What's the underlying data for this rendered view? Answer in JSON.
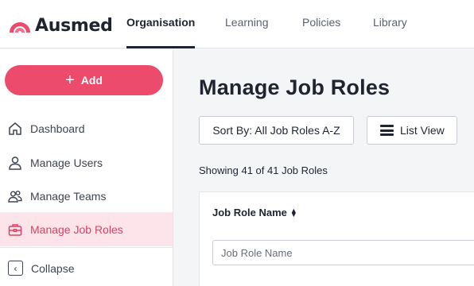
{
  "brand": {
    "name": "Ausmed",
    "accent": "#ec4b6c"
  },
  "topnav": {
    "tabs": [
      {
        "label": "Organisation",
        "active": true
      },
      {
        "label": "Learning",
        "active": false
      },
      {
        "label": "Policies",
        "active": false
      },
      {
        "label": "Library",
        "active": false
      }
    ]
  },
  "sidebar": {
    "add_label": "Add",
    "items": [
      {
        "label": "Dashboard",
        "icon": "home-icon"
      },
      {
        "label": "Manage Users",
        "icon": "user-icon"
      },
      {
        "label": "Manage Teams",
        "icon": "users-icon"
      },
      {
        "label": "Manage Job Roles",
        "icon": "briefcase-icon",
        "active": true
      }
    ],
    "collapse_label": "Collapse"
  },
  "main": {
    "title": "Manage Job Roles",
    "sort_label": "Sort By: All Job Roles A-Z",
    "view_label": "List View",
    "showing_text": "Showing 41 of 41 Job Roles",
    "table": {
      "column_header": "Job Role Name",
      "filter_placeholder": "Job Role Name"
    }
  }
}
